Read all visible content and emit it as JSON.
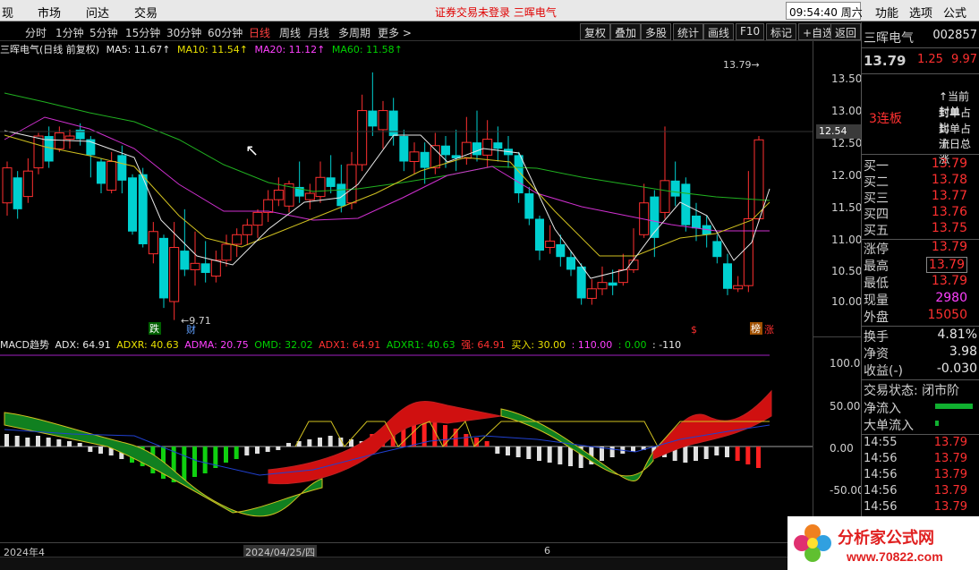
{
  "menubar": {
    "items": [
      "现",
      "市场",
      "问达",
      "交易"
    ],
    "notice": "证券交易未登录  三晖电气",
    "clock": "09:54:40 周六",
    "right_items": [
      "功能",
      "选项",
      "公式"
    ]
  },
  "toolbar": {
    "periods": [
      "分时",
      "1分钟",
      "5分钟",
      "15分钟",
      "30分钟",
      "60分钟",
      "日线",
      "周线",
      "月线",
      "多周期",
      "更多 >"
    ],
    "active_period": "日线",
    "buttons": [
      "复权",
      "叠加",
      "多股",
      "统计",
      "画线",
      "F10",
      "标记",
      "+自选",
      "返回"
    ]
  },
  "ma_legend": {
    "title": "三晖电气(日线 前复权)",
    "ma5": "MA5: 11.67↑",
    "ma10": "MA10: 11.54↑",
    "ma20": "MA20: 11.12↑",
    "ma60": "MA60: 11.58↑"
  },
  "main_chart": {
    "annotations": {
      "low_label": "←9.71",
      "high_label": "13.79→",
      "tag_die": "跌",
      "tag_cai": "财",
      "tag_dollar": "$",
      "tag_bang": "榜",
      "tag_zhang": "涨"
    },
    "price_ticks": [
      "13.50",
      "13.00",
      "12.50",
      "12.00",
      "11.50",
      "11.00",
      "10.50",
      "10.00"
    ],
    "current_price_label": "12.54"
  },
  "indicator": {
    "legend": {
      "name": "MACD趋势",
      "adx": "ADX: 64.91",
      "adxr": "ADXR: 40.63",
      "adma": "ADMA: 20.75",
      "omd": "OMD: 32.02",
      "adx1": "ADX1: 64.91",
      "adxr1": "ADXR1: 40.63",
      "strong": "强: 64.91",
      "buy": "买入: 30.00",
      "v110": ": 110.00",
      "v0": ": 0.00",
      "vm110": ": -110"
    },
    "ticks": [
      "100.00",
      "50.00",
      "0.00",
      "-50.00"
    ]
  },
  "date_axis": {
    "labels": [
      "2024年4",
      "2024/04/25/四",
      "6"
    ]
  },
  "quote": {
    "name": "三晖电气",
    "code": "002857",
    "price": "13.79",
    "change": "1.25",
    "pct": "9.97",
    "streak": "3连板",
    "seal_lines": [
      "↑当前封单",
      "封单占比",
      "封单占流",
      "十日总涨"
    ],
    "bids": [
      {
        "label": "买一",
        "price": "13.79"
      },
      {
        "label": "买二",
        "price": "13.78"
      },
      {
        "label": "买三",
        "price": "13.77"
      },
      {
        "label": "买四",
        "price": "13.76"
      },
      {
        "label": "买五",
        "price": "13.75"
      }
    ],
    "stats": [
      {
        "label": "涨停",
        "value": "13.79"
      },
      {
        "label": "最高",
        "value": "13.79"
      },
      {
        "label": "最低",
        "value": "13.79"
      },
      {
        "label": "现量",
        "value": "2980"
      },
      {
        "label": "外盘",
        "value": "15050"
      }
    ],
    "turnover_label": "换手",
    "turnover": "4.81%",
    "nav_label": "净资",
    "nav": "3.98",
    "eps_label": "收益(-)",
    "eps": "-0.030",
    "status": "交易状态: 闭市阶",
    "net_inflow_label": "净流入",
    "big_inflow_label": "大单流入",
    "ticks": [
      {
        "time": "14:55",
        "price": "13.79"
      },
      {
        "time": "14:56",
        "price": "13.79"
      },
      {
        "time": "14:56",
        "price": "13.79"
      },
      {
        "time": "14:56",
        "price": "13.79"
      },
      {
        "time": "14:56",
        "price": "13.79"
      }
    ]
  },
  "logo": {
    "line1": "分析家公式网",
    "line2": "www.70822.com"
  },
  "chart_data": {
    "type": "candlestick",
    "ylim": [
      9.5,
      13.8
    ],
    "candles": [
      [
        11.55,
        12.1,
        12.2,
        11.35
      ],
      [
        11.95,
        11.45,
        12.05,
        11.3
      ],
      [
        11.65,
        12.05,
        12.25,
        11.55
      ],
      [
        12.1,
        12.6,
        12.65,
        12.0
      ],
      [
        12.6,
        12.2,
        12.75,
        12.1
      ],
      [
        12.4,
        12.65,
        12.75,
        12.35
      ],
      [
        12.55,
        12.6,
        12.7,
        12.4
      ],
      [
        12.7,
        12.55,
        12.8,
        12.45
      ],
      [
        12.55,
        12.3,
        12.6,
        11.95
      ],
      [
        12.2,
        11.85,
        12.25,
        11.7
      ],
      [
        11.75,
        12.2,
        12.35,
        11.7
      ],
      [
        12.3,
        11.9,
        12.45,
        11.7
      ],
      [
        11.95,
        11.1,
        12.0,
        11.05
      ],
      [
        12.0,
        10.9,
        12.1,
        10.85
      ],
      [
        10.75,
        11.1,
        11.25,
        10.6
      ],
      [
        11.0,
        10.05,
        11.05,
        9.9
      ],
      [
        10.0,
        10.85,
        11.25,
        9.71
      ],
      [
        10.8,
        10.5,
        11.45,
        10.4
      ],
      [
        10.5,
        10.6,
        11.1,
        10.25
      ],
      [
        10.6,
        10.45,
        10.95,
        10.3
      ],
      [
        10.4,
        10.65,
        10.8,
        10.3
      ],
      [
        10.65,
        10.9,
        11.05,
        10.55
      ],
      [
        10.9,
        11.05,
        11.15,
        10.7
      ],
      [
        11.05,
        11.2,
        11.3,
        10.9
      ],
      [
        11.2,
        11.4,
        11.45,
        11.0
      ],
      [
        11.4,
        11.6,
        11.75,
        11.25
      ],
      [
        11.6,
        11.75,
        11.95,
        11.5
      ],
      [
        11.5,
        11.85,
        11.9,
        11.4
      ],
      [
        11.8,
        11.65,
        12.2,
        11.55
      ],
      [
        11.6,
        11.7,
        11.85,
        11.45
      ],
      [
        11.65,
        11.95,
        12.2,
        11.55
      ],
      [
        11.95,
        11.8,
        12.3,
        11.7
      ],
      [
        11.85,
        11.5,
        12.15,
        11.4
      ],
      [
        11.55,
        12.15,
        12.35,
        11.45
      ],
      [
        12.15,
        13.0,
        13.25,
        12.05
      ],
      [
        13.0,
        12.75,
        13.6,
        12.6
      ],
      [
        12.7,
        13.0,
        13.15,
        12.4
      ],
      [
        13.0,
        12.6,
        13.2,
        12.45
      ],
      [
        12.6,
        12.2,
        12.7,
        12.05
      ],
      [
        12.2,
        12.35,
        12.5,
        12.0
      ],
      [
        12.35,
        12.1,
        12.5,
        11.85
      ],
      [
        12.1,
        12.45,
        12.65,
        12.0
      ],
      [
        12.45,
        12.3,
        12.6,
        12.1
      ],
      [
        12.3,
        12.25,
        12.7,
        12.05
      ],
      [
        12.25,
        12.5,
        12.9,
        12.15
      ],
      [
        12.5,
        12.3,
        13.0,
        12.2
      ],
      [
        12.3,
        12.55,
        12.85,
        12.1
      ],
      [
        12.5,
        12.4,
        12.75,
        12.2
      ],
      [
        12.4,
        12.3,
        12.6,
        12.1
      ],
      [
        12.3,
        11.7,
        12.35,
        11.55
      ],
      [
        11.7,
        11.3,
        11.8,
        11.2
      ],
      [
        11.3,
        10.8,
        11.35,
        10.65
      ],
      [
        10.85,
        10.95,
        11.2,
        10.75
      ],
      [
        10.9,
        10.7,
        11.05,
        10.55
      ],
      [
        10.7,
        10.5,
        10.8,
        10.4
      ],
      [
        10.55,
        10.05,
        10.6,
        9.95
      ],
      [
        10.05,
        10.2,
        10.35,
        9.95
      ],
      [
        10.2,
        10.3,
        10.55,
        10.1
      ],
      [
        10.3,
        10.25,
        10.5,
        10.1
      ],
      [
        10.3,
        10.5,
        10.75,
        10.25
      ],
      [
        10.5,
        10.65,
        11.15,
        10.45
      ],
      [
        11.05,
        11.55,
        11.85,
        11.0
      ],
      [
        11.65,
        11.0,
        11.75,
        10.7
      ],
      [
        11.4,
        11.9,
        12.75,
        11.3
      ],
      [
        11.9,
        11.65,
        12.2,
        11.5
      ],
      [
        11.85,
        11.2,
        11.95,
        11.1
      ],
      [
        11.35,
        11.15,
        11.55,
        10.95
      ],
      [
        11.2,
        11.05,
        11.35,
        10.85
      ],
      [
        10.95,
        10.7,
        11.05,
        10.6
      ],
      [
        10.6,
        10.2,
        10.75,
        10.1
      ],
      [
        10.2,
        10.25,
        10.4,
        10.15
      ],
      [
        10.25,
        11.3,
        12.05,
        10.15
      ],
      [
        11.3,
        12.54,
        12.6,
        11.25
      ]
    ]
  }
}
